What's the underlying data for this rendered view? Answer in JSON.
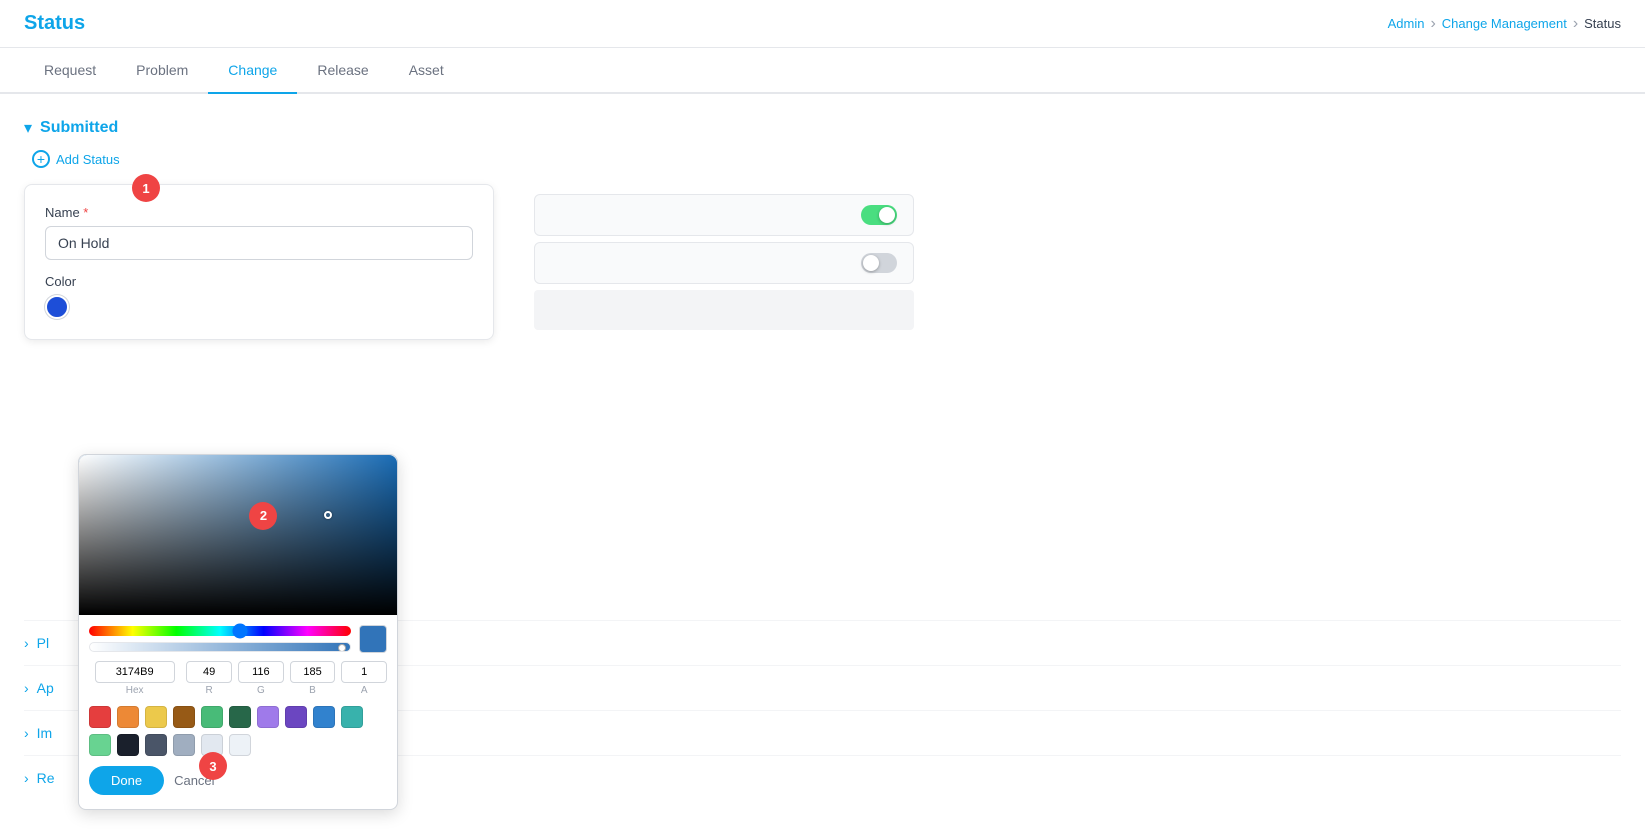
{
  "header": {
    "title": "Status",
    "breadcrumb": {
      "admin": "Admin",
      "change_management": "Change Management",
      "current": "Status"
    }
  },
  "tabs": [
    {
      "id": "request",
      "label": "Request",
      "active": false
    },
    {
      "id": "problem",
      "label": "Problem",
      "active": false
    },
    {
      "id": "change",
      "label": "Change",
      "active": true
    },
    {
      "id": "release",
      "label": "Release",
      "active": false
    },
    {
      "id": "asset",
      "label": "Asset",
      "active": false
    }
  ],
  "section_submitted": {
    "title": "Submitted",
    "add_status_label": "Add Status"
  },
  "form": {
    "name_label": "Name",
    "name_value": "On Hold",
    "color_label": "Color"
  },
  "color_picker": {
    "hex_value": "3174B9",
    "r_value": "49",
    "g_value": "116",
    "b_value": "185",
    "a_value": "1",
    "hex_label": "Hex",
    "r_label": "R",
    "g_label": "G",
    "b_label": "B",
    "a_label": "A",
    "done_label": "Done",
    "cancel_label": "Cancel",
    "preset_colors": [
      "#e53e3e",
      "#ed8936",
      "#ecc94b",
      "#975a16",
      "#48bb78",
      "#276749",
      "#9f7aea",
      "#6b46c1",
      "#3182ce",
      "#38b2ac",
      "#68d391",
      "#1a202c",
      "#4a5568",
      "#a0aec0",
      "#e2e8f0",
      "#edf2f7"
    ]
  },
  "collapsed_sections": [
    {
      "id": "pi",
      "label": "Pi..."
    },
    {
      "id": "ap",
      "label": "Ap..."
    },
    {
      "id": "im",
      "label": "Im..."
    },
    {
      "id": "re",
      "label": "Re..."
    }
  ],
  "steps": {
    "step1": "1",
    "step2": "2",
    "step3": "3"
  }
}
